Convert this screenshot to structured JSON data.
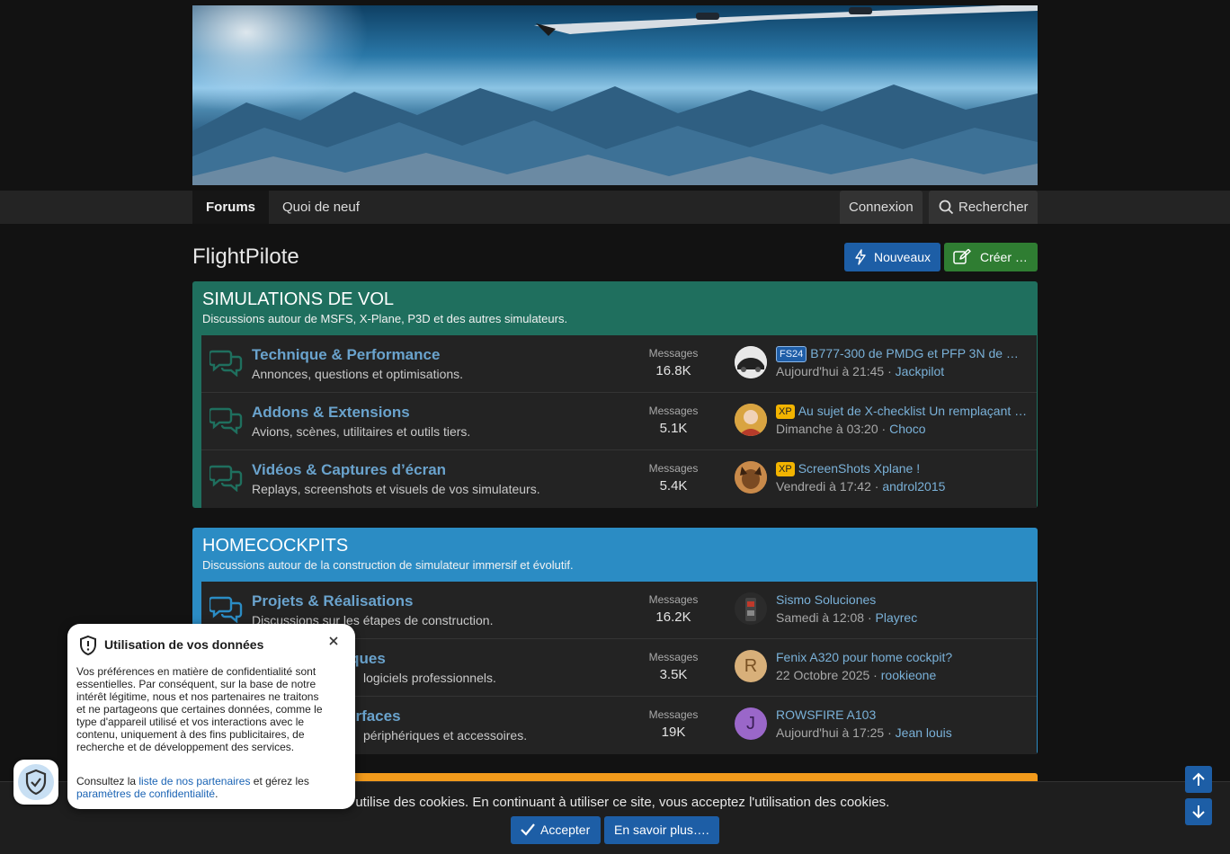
{
  "nav": {
    "tabs": [
      "Forums",
      "Quoi de neuf"
    ],
    "login_label": "Connexion",
    "search_label": "Rechercher"
  },
  "header": {
    "title": "FlightPilote",
    "new_label": "Nouveaux",
    "create_label": "Créer …"
  },
  "categories": [
    {
      "title": "SIMULATIONS DE VOL",
      "description": "Discussions autour de MSFS, X-Plane, P3D et des autres simulateurs.",
      "color": "#1f6f5e",
      "nodes": [
        {
          "title": "Technique & Performance",
          "description": "Annonces, questions et optimisations.",
          "stat_label": "Messages",
          "stat_value": "16.8K",
          "prefix": "FS24",
          "last_title": "B777-300 de PMDG et PFP 3N de …",
          "last_date": "Aujourd'hui à 21:45",
          "last_user": "Jackpilot"
        },
        {
          "title": "Addons & Extensions",
          "description": "Avions, scènes, utilitaires et outils tiers.",
          "stat_label": "Messages",
          "stat_value": "5.1K",
          "prefix": "XP",
          "last_title": "Au sujet de X-checklist Un remplaçant …",
          "last_date": "Dimanche à 03:20",
          "last_user": "Choco"
        },
        {
          "title": "Vidéos & Captures d’écran",
          "description": "Replays, screenshots et visuels de vos simulateurs.",
          "stat_label": "Messages",
          "stat_value": "5.4K",
          "prefix": "XP",
          "last_title": "ScreenShots Xplane !",
          "last_date": "Vendredi à 17:42",
          "last_user": "androl2015"
        }
      ]
    },
    {
      "title": "HOMECOCKPITS",
      "description": "Discussions autour de la construction de simulateur immersif et évolutif.",
      "color": "#2b8cc4",
      "nodes": [
        {
          "title": "Projets & Réalisations",
          "description": "Discussions sur les étapes de construction.",
          "stat_label": "Messages",
          "stat_value": "16.2K",
          "last_title": "Sismo Soluciones",
          "last_date": "Samedi à 12:08",
          "last_user": "Playrec"
        },
        {
          "title": "niques",
          "description": "logiciels professionnels.",
          "stat_label": "Messages",
          "stat_value": "3.5K",
          "avatar_letter": "R",
          "last_title": "Fenix A320 pour home cockpit?",
          "last_date": "22 Octobre 2025",
          "last_user": "rookieone"
        },
        {
          "title": "erfaces",
          "description": "périphériques et accessoires.",
          "stat_label": "Messages",
          "stat_value": "19K",
          "avatar_letter": "J",
          "last_title": "ROWSFIRE A103",
          "last_date": "Aujourd'hui à 17:25",
          "last_user": "Jean louis"
        }
      ]
    }
  ],
  "cookie": {
    "text": "te utilise des cookies. En continuant à utiliser ce site, vous acceptez l'utilisation des cookies.",
    "accept_label": "Accepter",
    "more_label": "En savoir plus…."
  },
  "privacy": {
    "title": "Utilisation de vos données",
    "body": "Vos préférences en matière de confidentialité sont essentielles. Par conséquent, sur la base de notre intérêt légitime, nous et nos partenaires ne traitons et ne partageons que certaines données, comme le type d'appareil utilisé et vos interactions avec le contenu, uniquement à des fins publicitaires, de recherche et de développement des services.",
    "foot_prefix": "Consultez la ",
    "partners_link": "liste de nos partenaires",
    "foot_middle": " et gérez les ",
    "settings_link": "paramètres de confidentialité",
    "foot_suffix": "."
  },
  "colors": {
    "accent_blue": "#1d5ea6",
    "accent_green": "#2f7d32",
    "link": "#6aa3cd",
    "category_green": "#1f6f5e",
    "category_blue": "#2b8cc4",
    "orange": "#f29a1b"
  },
  "icons": {
    "node": "comments-icon",
    "search": "search-icon",
    "new": "bolt-icon",
    "create": "edit-icon",
    "privacy": "shield-check-icon",
    "close": "close-icon",
    "accept": "check-icon",
    "scroll_up": "arrow-up-icon",
    "scroll_down": "arrow-down-icon"
  }
}
